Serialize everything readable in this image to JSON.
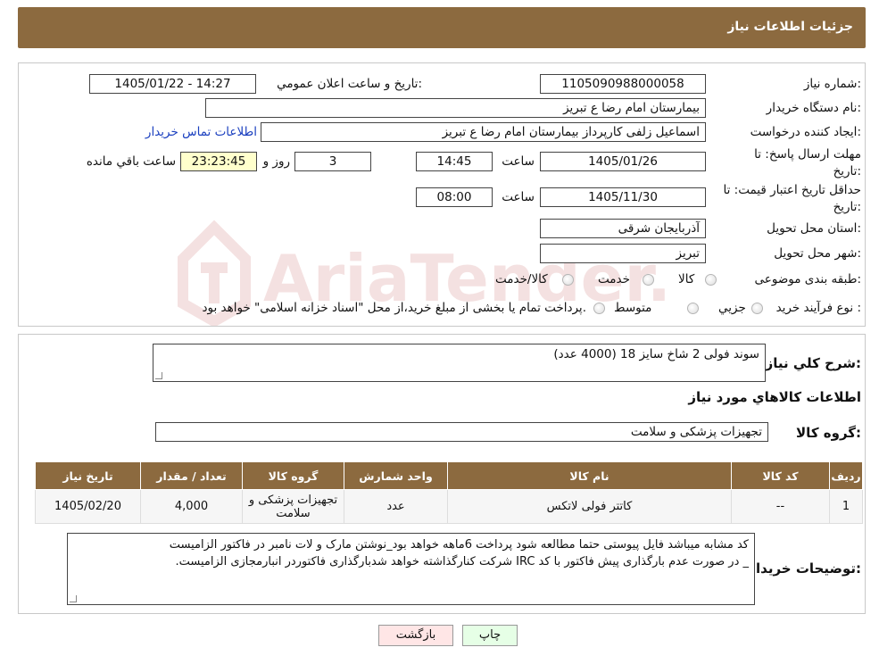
{
  "header": {
    "title": "جزئیات اطلاعات نیاز"
  },
  "labels": {
    "need_number": "شماره نیاز:",
    "announce_datetime": "تاریخ و ساعت اعلان عمومي:",
    "buyer_org": "نام دستگاه خريدار:",
    "requester": "ايجاد کننده درخواست:",
    "contact_link": "اطلاعات تماس خريدار",
    "deadline_line1": "مهلت ارسال پاسخ: تا",
    "deadline_line2": "تاريخ:",
    "time": "ساعت",
    "days_and": "روز و",
    "remaining": "ساعت باقي مانده",
    "price_valid_line1": "حداقل تاريخ اعتبار قيمت: تا",
    "price_valid_line2": "تاريخ:",
    "province": "استان محل تحويل:",
    "city": "شهر محل تحويل:",
    "category": "طبقه بندی موضوعی:",
    "process": "نوع فرآيند خريد :",
    "description": "شرح کلي نياز:",
    "goods_info": "اطلاعات کالاهاي مورد نياز",
    "goods_group": "گروه کالا:",
    "buyer_notes": "توضيحات خريدار:"
  },
  "values": {
    "need_number": "1105090988000058",
    "announce_datetime": "1405/01/22 - 14:27",
    "buyer_org": "بيمارستان امام رضا  ع  تبريز",
    "requester": "اسماعيل زلفی کارپرداز بيمارستان امام رضا  ع  تبريز",
    "deadline_date": "1405/01/26",
    "deadline_time": "14:45",
    "days": "3",
    "remaining_time": "23:23:45",
    "price_valid_date": "1405/11/30",
    "price_valid_time": "08:00",
    "province": "آذربايجان شرقی",
    "city": "تبريز",
    "description": "سوند فولی 2 شاخ سایز 18 (4000 عدد)",
    "goods_group": "تجهيزات پزشکی و سلامت",
    "buyer_notes_line1": "کد مشابه میباشد فایل پیوستی حتما مطالعه شود  پرداخت 6ماهه خواهد بود_نوشتن مارک و لات نامبر در فاکتور الزامیست",
    "buyer_notes_line2": "_  در صورت عدم بارگذاری پیش فاکتور با کد IRC  شرکت کنارگذاشته خواهد شدبارگذاری فاکتوردر انبارمجازی الزامیست."
  },
  "category_options": [
    "کالا",
    "خدمت",
    "کالا/خدمت"
  ],
  "process_options": [
    "جزيي",
    "متوسط"
  ],
  "process_note": "پرداخت تمام يا بخشی از مبلغ خريد،از محل \"اسناد خزانه اسلامی\" خواهد بود.",
  "watermark": "AriaTender.neT",
  "table": {
    "headers": [
      "رديف",
      "کد کالا",
      "نام کالا",
      "واحد شمارش",
      "گروه کالا",
      "تعداد / مقدار",
      "تاريخ نياز"
    ],
    "rows": [
      {
        "row": "1",
        "code": "--",
        "name": "کاتتر فولی لاتکس",
        "unit": "عدد",
        "group": "تجهيزات پزشکی و سلامت",
        "qty": "4,000",
        "date": "1405/02/20"
      }
    ]
  },
  "buttons": {
    "print": "چاپ",
    "back": "بازگشت"
  },
  "colors": {
    "header_bg": "#8c6a3f",
    "back_btn_bg": "#ffe6e6",
    "print_btn_bg": "#e6ffe6",
    "remaining_bg": "#ffffcc",
    "link": "#1a3fbf"
  }
}
